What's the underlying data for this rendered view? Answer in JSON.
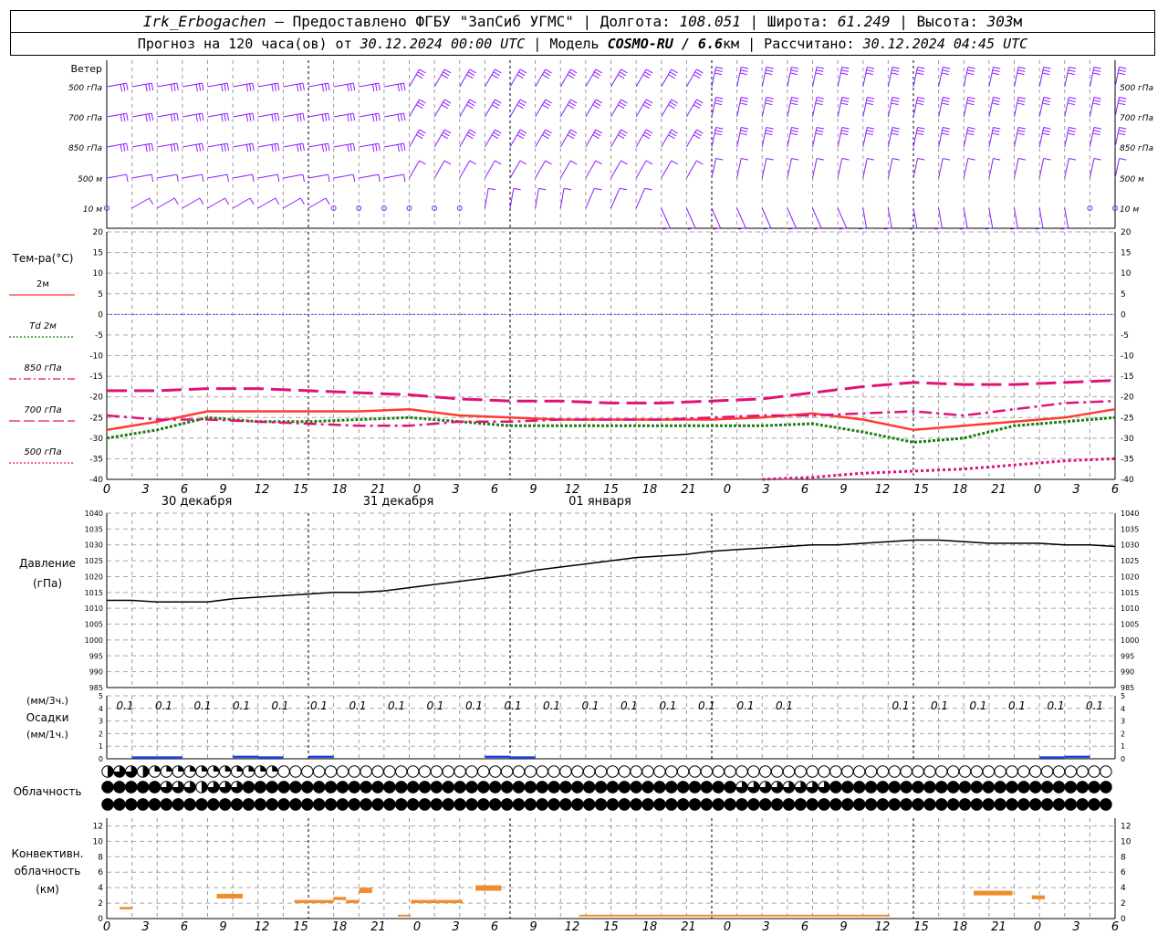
{
  "header": {
    "line1": {
      "station": "Irk_Erbogachen",
      "provider": " – Предоставлено ФГБУ \"ЗапСиб УГМС\" | ",
      "lon_label": "Долгота: ",
      "lon": "108.051",
      "lat_label": " | Широта: ",
      "lat": "61.249",
      "alt_label": " | Высота: ",
      "alt": "303",
      "alt_unit": "м"
    },
    "line2": {
      "forecast_label": "Прогноз на 120 часа(ов) от ",
      "forecast_from": "30.12.2024 00:00 UTC",
      "model_label": "  | Модель ",
      "model": "COSMO-RU / 6.6",
      "model_unit": "км",
      "calc_label": " | Рассчитано: ",
      "calc_time": "30.12.2024 04:45 UTC"
    }
  },
  "time_axis": {
    "hour_ticks": [
      "0",
      "3",
      "6",
      "9",
      "12",
      "15",
      "18",
      "21",
      "0",
      "3",
      "6",
      "9",
      "12",
      "15",
      "18",
      "21",
      "0",
      "3",
      "6",
      "9",
      "12",
      "15",
      "18",
      "21",
      "0",
      "3",
      "6"
    ],
    "day_labels": [
      "30 декабря",
      "31 декабря",
      "01 января"
    ]
  },
  "panels": {
    "wind": {
      "title": "Ветер",
      "levels": [
        "500 гПа",
        "700 гПа",
        "850 гПа",
        "500 м",
        "10  м"
      ],
      "color": "#8b1cff"
    },
    "temperature": {
      "title": "Тем-ра(°C)",
      "legend": [
        {
          "label": "2м",
          "color": "#ff3b30",
          "style": "solid"
        },
        {
          "label": "Td  2м",
          "color": "#1e7d12",
          "style": "dotted"
        },
        {
          "label": "850 гПа",
          "color": "#e0127a",
          "style": "dashdot"
        },
        {
          "label": "700 гПа",
          "color": "#e0127a",
          "style": "longdash"
        },
        {
          "label": "500 гПа",
          "color": "#e0127a",
          "style": "dotted"
        }
      ],
      "y_ticks": [
        "20",
        "15",
        "10",
        "5",
        "0",
        "-5",
        "-10",
        "-15",
        "-20",
        "-25",
        "-30",
        "-35",
        "-40"
      ]
    },
    "pressure": {
      "title_line1": "Давление",
      "title_line2": "(гПа)",
      "y_ticks": [
        "1040",
        "1035",
        "1030",
        "1025",
        "1020",
        "1015",
        "1010",
        "1005",
        "1000",
        "995",
        "990",
        "985"
      ]
    },
    "precip": {
      "title_line1": "(мм/3ч.)",
      "title_line2": "Осадки",
      "title_line3": "(мм/1ч.)",
      "y_ticks": [
        "5",
        "4",
        "3",
        "2",
        "1",
        "0"
      ],
      "values_3h": [
        "0.1",
        "0.1",
        "0.1",
        "0.1",
        "0.1",
        "0.1",
        "0.1",
        "0.1",
        "0.1",
        "0.1",
        "0.1",
        "0.1",
        "0.1",
        "0.1",
        "0.1",
        "0.1",
        "0.1",
        "0.1",
        "",
        "",
        "0.1",
        "0.1",
        "0.1",
        "0.1",
        "0.1",
        "0.1"
      ]
    },
    "cloud": {
      "title": "Облачность"
    },
    "convective": {
      "title_line1": "Конвективн.",
      "title_line2": "облачность",
      "title_line3": "(км)",
      "y_ticks": [
        "12",
        "10",
        "8",
        "6",
        "4",
        "2",
        "0"
      ]
    }
  },
  "chart_data": [
    {
      "type": "line",
      "title": "Тем-ра(°C)",
      "x": [
        0,
        6,
        12,
        18,
        24,
        30,
        36,
        42,
        48,
        54,
        60,
        66,
        72,
        78,
        84,
        90,
        96,
        102,
        108,
        114,
        120
      ],
      "ylim": [
        -40,
        20
      ],
      "series": [
        {
          "name": "2м",
          "values": [
            -28,
            -26,
            -23.5,
            -23.5,
            -23.5,
            -23.5,
            -23,
            -24.5,
            -25,
            -25.5,
            -25.5,
            -25.5,
            -25.5,
            -25,
            -24,
            -25.5,
            -28,
            -27,
            -26,
            -25,
            -23
          ]
        },
        {
          "name": "Td  2м",
          "values": [
            -30,
            -28,
            -25,
            -26,
            -26,
            -25.5,
            -25,
            -26,
            -27,
            -27,
            -27,
            -27,
            -27,
            -27,
            -26.5,
            -28.5,
            -31,
            -30,
            -27,
            -26,
            -25
          ]
        },
        {
          "name": "850 гПа",
          "values": [
            -24.5,
            -25.5,
            -25.5,
            -26,
            -26.5,
            -27,
            -27,
            -26,
            -26,
            -25.5,
            -25.5,
            -25.5,
            -25,
            -24.5,
            -24.5,
            -24,
            -23.5,
            -24.5,
            -23,
            -21.5,
            -21
          ]
        },
        {
          "name": "700 гПа",
          "values": [
            -18.5,
            -18.5,
            -18,
            -18,
            -18.5,
            -19,
            -19.5,
            -20.5,
            -21,
            -21,
            -21.5,
            -21.5,
            -21,
            -20.5,
            -19,
            -17.5,
            -16.5,
            -17,
            -17,
            -16.5,
            -16
          ]
        },
        {
          "name": "500 гПа",
          "values": [
            null,
            null,
            null,
            null,
            null,
            null,
            null,
            null,
            null,
            null,
            null,
            null,
            null,
            -40,
            -39.5,
            -38.5,
            -38,
            -37.5,
            -36.5,
            -35.5,
            -35
          ]
        }
      ]
    },
    {
      "type": "line",
      "title": "Давление",
      "x": [
        0,
        3,
        6,
        9,
        12,
        15,
        18,
        21,
        24,
        27,
        30,
        33,
        36,
        39,
        42,
        45,
        48,
        51,
        54,
        57,
        60,
        63,
        66,
        69,
        72,
        75,
        78,
        81,
        84,
        87,
        90,
        93,
        96,
        99,
        102,
        105,
        108,
        111,
        114,
        117,
        120
      ],
      "ylim": [
        985,
        1040
      ],
      "series": [
        {
          "name": "",
          "values": [
            1012.5,
            1012.5,
            1012,
            1012,
            1012,
            1013,
            1013.5,
            1014,
            1014.5,
            1015,
            1015,
            1015.5,
            1016.5,
            1017.5,
            1018.5,
            1019.5,
            1020.5,
            1022,
            1023,
            1024,
            1025,
            1026,
            1026.5,
            1027,
            1028,
            1028.5,
            1029,
            1029.5,
            1030,
            1030,
            1030.5,
            1031,
            1031.5,
            1031.5,
            1031,
            1030.5,
            1030.5,
            1030.5,
            1030,
            1030,
            1029.5
          ]
        }
      ]
    },
    {
      "type": "bar",
      "title": "Осадки",
      "ylim": [
        0,
        5
      ],
      "bars_3h": {
        "x": [
          3,
          6,
          9,
          12,
          15,
          18,
          21,
          24,
          27,
          30,
          33,
          36,
          39,
          42,
          45,
          48,
          51,
          54,
          57,
          60,
          63,
          66,
          69,
          72,
          75,
          78,
          81,
          84,
          87,
          90,
          93,
          96,
          99,
          102,
          105,
          108,
          111,
          114,
          117,
          120
        ],
        "values": [
          0,
          0.05,
          0.05,
          0,
          0,
          0.1,
          0.05,
          0,
          0.1,
          0,
          0,
          0,
          0,
          0,
          0,
          0.1,
          0.05,
          0,
          0,
          0,
          0,
          0,
          0,
          0,
          0,
          0,
          0,
          0,
          0,
          0,
          0,
          0,
          0,
          0,
          0,
          0,
          0,
          0.05,
          0.1,
          0
        ]
      }
    },
    {
      "type": "table",
      "title": "Облачность",
      "note": "cloud cover fraction per hour (0..1), rows: upper, middle, lower",
      "upper": [
        0.5,
        0.75,
        0.75,
        0.5,
        0.25,
        0.25,
        0.25,
        0.25,
        0.25,
        0.25,
        0.25,
        0.25,
        0.25,
        0.25,
        0.25,
        0.25,
        0.25,
        0.25,
        0.25,
        0.25,
        0.25,
        0.25,
        0.25,
        0.25,
        0.25,
        0.25,
        0.25,
        0.25,
        0.25,
        0.25,
        0.25,
        0.25,
        0.25,
        0.25,
        0.25,
        0.25,
        0.5,
        0.5,
        0.5,
        0.5,
        0.5,
        0.5,
        0.5,
        0.5,
        0.5,
        0.5,
        0.5,
        0.5,
        0.5,
        0.5,
        0.5,
        0.5,
        0.5,
        0.5,
        0.5,
        0.5,
        0.5,
        0.5,
        0.5,
        0.5,
        0.5,
        0.5,
        0.5,
        0.5,
        0.5,
        0.5,
        0.5,
        0.5,
        0.5,
        0.5,
        0.5,
        0.5,
        0.5,
        0.5,
        0.5,
        0.5,
        0.5,
        0.5,
        0.5,
        0.5,
        0.5,
        0.5,
        0.5,
        0.5,
        0.5,
        0.5
      ],
      "middle": [
        1,
        1,
        1,
        1,
        1,
        0.75,
        0.75,
        0.75,
        0.5,
        0.75,
        0.75,
        0.75,
        1,
        1,
        1,
        1,
        1,
        1,
        1,
        1,
        1,
        1,
        1,
        1,
        1,
        1,
        1,
        1,
        1,
        1,
        1,
        1,
        1,
        1,
        1,
        1,
        1,
        1,
        1,
        1,
        1,
        1,
        1,
        1,
        1,
        1,
        1,
        1,
        1,
        1,
        1,
        1,
        1,
        1,
        0.75,
        0.75,
        0.75,
        0.75,
        0.75,
        0.75,
        0.75,
        0.75,
        1,
        1,
        1,
        1,
        1,
        1,
        1,
        1,
        1,
        1,
        1,
        1,
        1,
        1,
        1,
        1,
        1,
        1,
        1,
        1,
        1,
        1,
        1,
        1,
        1,
        1,
        0.75,
        0.75,
        0.5,
        0.5,
        0.25,
        0.25,
        0,
        0,
        0,
        0,
        0,
        0,
        0,
        0,
        0,
        0,
        0,
        0,
        0,
        0,
        0,
        0,
        0,
        0,
        0.75,
        1,
        1,
        1,
        1,
        1,
        1,
        1,
        1,
        1,
        1,
        1,
        0.75,
        0,
        0,
        0,
        0,
        0,
        0
      ],
      "lower": 1
    },
    {
      "type": "bar",
      "title": "Конвективн. облачность",
      "ylim": [
        0,
        13
      ],
      "segments": [
        {
          "x0": 1,
          "x1": 2,
          "bottom": 1.2,
          "top": 1.5
        },
        {
          "x0": 8.5,
          "x1": 10.5,
          "bottom": 2.6,
          "top": 3.2
        },
        {
          "x0": 14.5,
          "x1": 17.5,
          "bottom": 2.0,
          "top": 2.4
        },
        {
          "x0": 17.5,
          "x1": 18.5,
          "bottom": 2.4,
          "top": 2.8
        },
        {
          "x0": 18.5,
          "x1": 19.5,
          "bottom": 2.0,
          "top": 2.4
        },
        {
          "x0": 19.5,
          "x1": 20.5,
          "bottom": 3.3,
          "top": 4.0
        },
        {
          "x0": 22.5,
          "x1": 23.5,
          "bottom": 0.3,
          "top": 0.5
        },
        {
          "x0": 23.5,
          "x1": 27.5,
          "bottom": 2.0,
          "top": 2.4
        },
        {
          "x0": 28.5,
          "x1": 30.5,
          "bottom": 3.6,
          "top": 4.3
        },
        {
          "x0": 36.5,
          "x1": 60.5,
          "bottom": 0.3,
          "top": 0.5
        },
        {
          "x0": 67,
          "x1": 70,
          "bottom": 3.0,
          "top": 3.6
        },
        {
          "x0": 71.5,
          "x1": 72.5,
          "bottom": 2.5,
          "top": 3.0
        }
      ]
    }
  ]
}
